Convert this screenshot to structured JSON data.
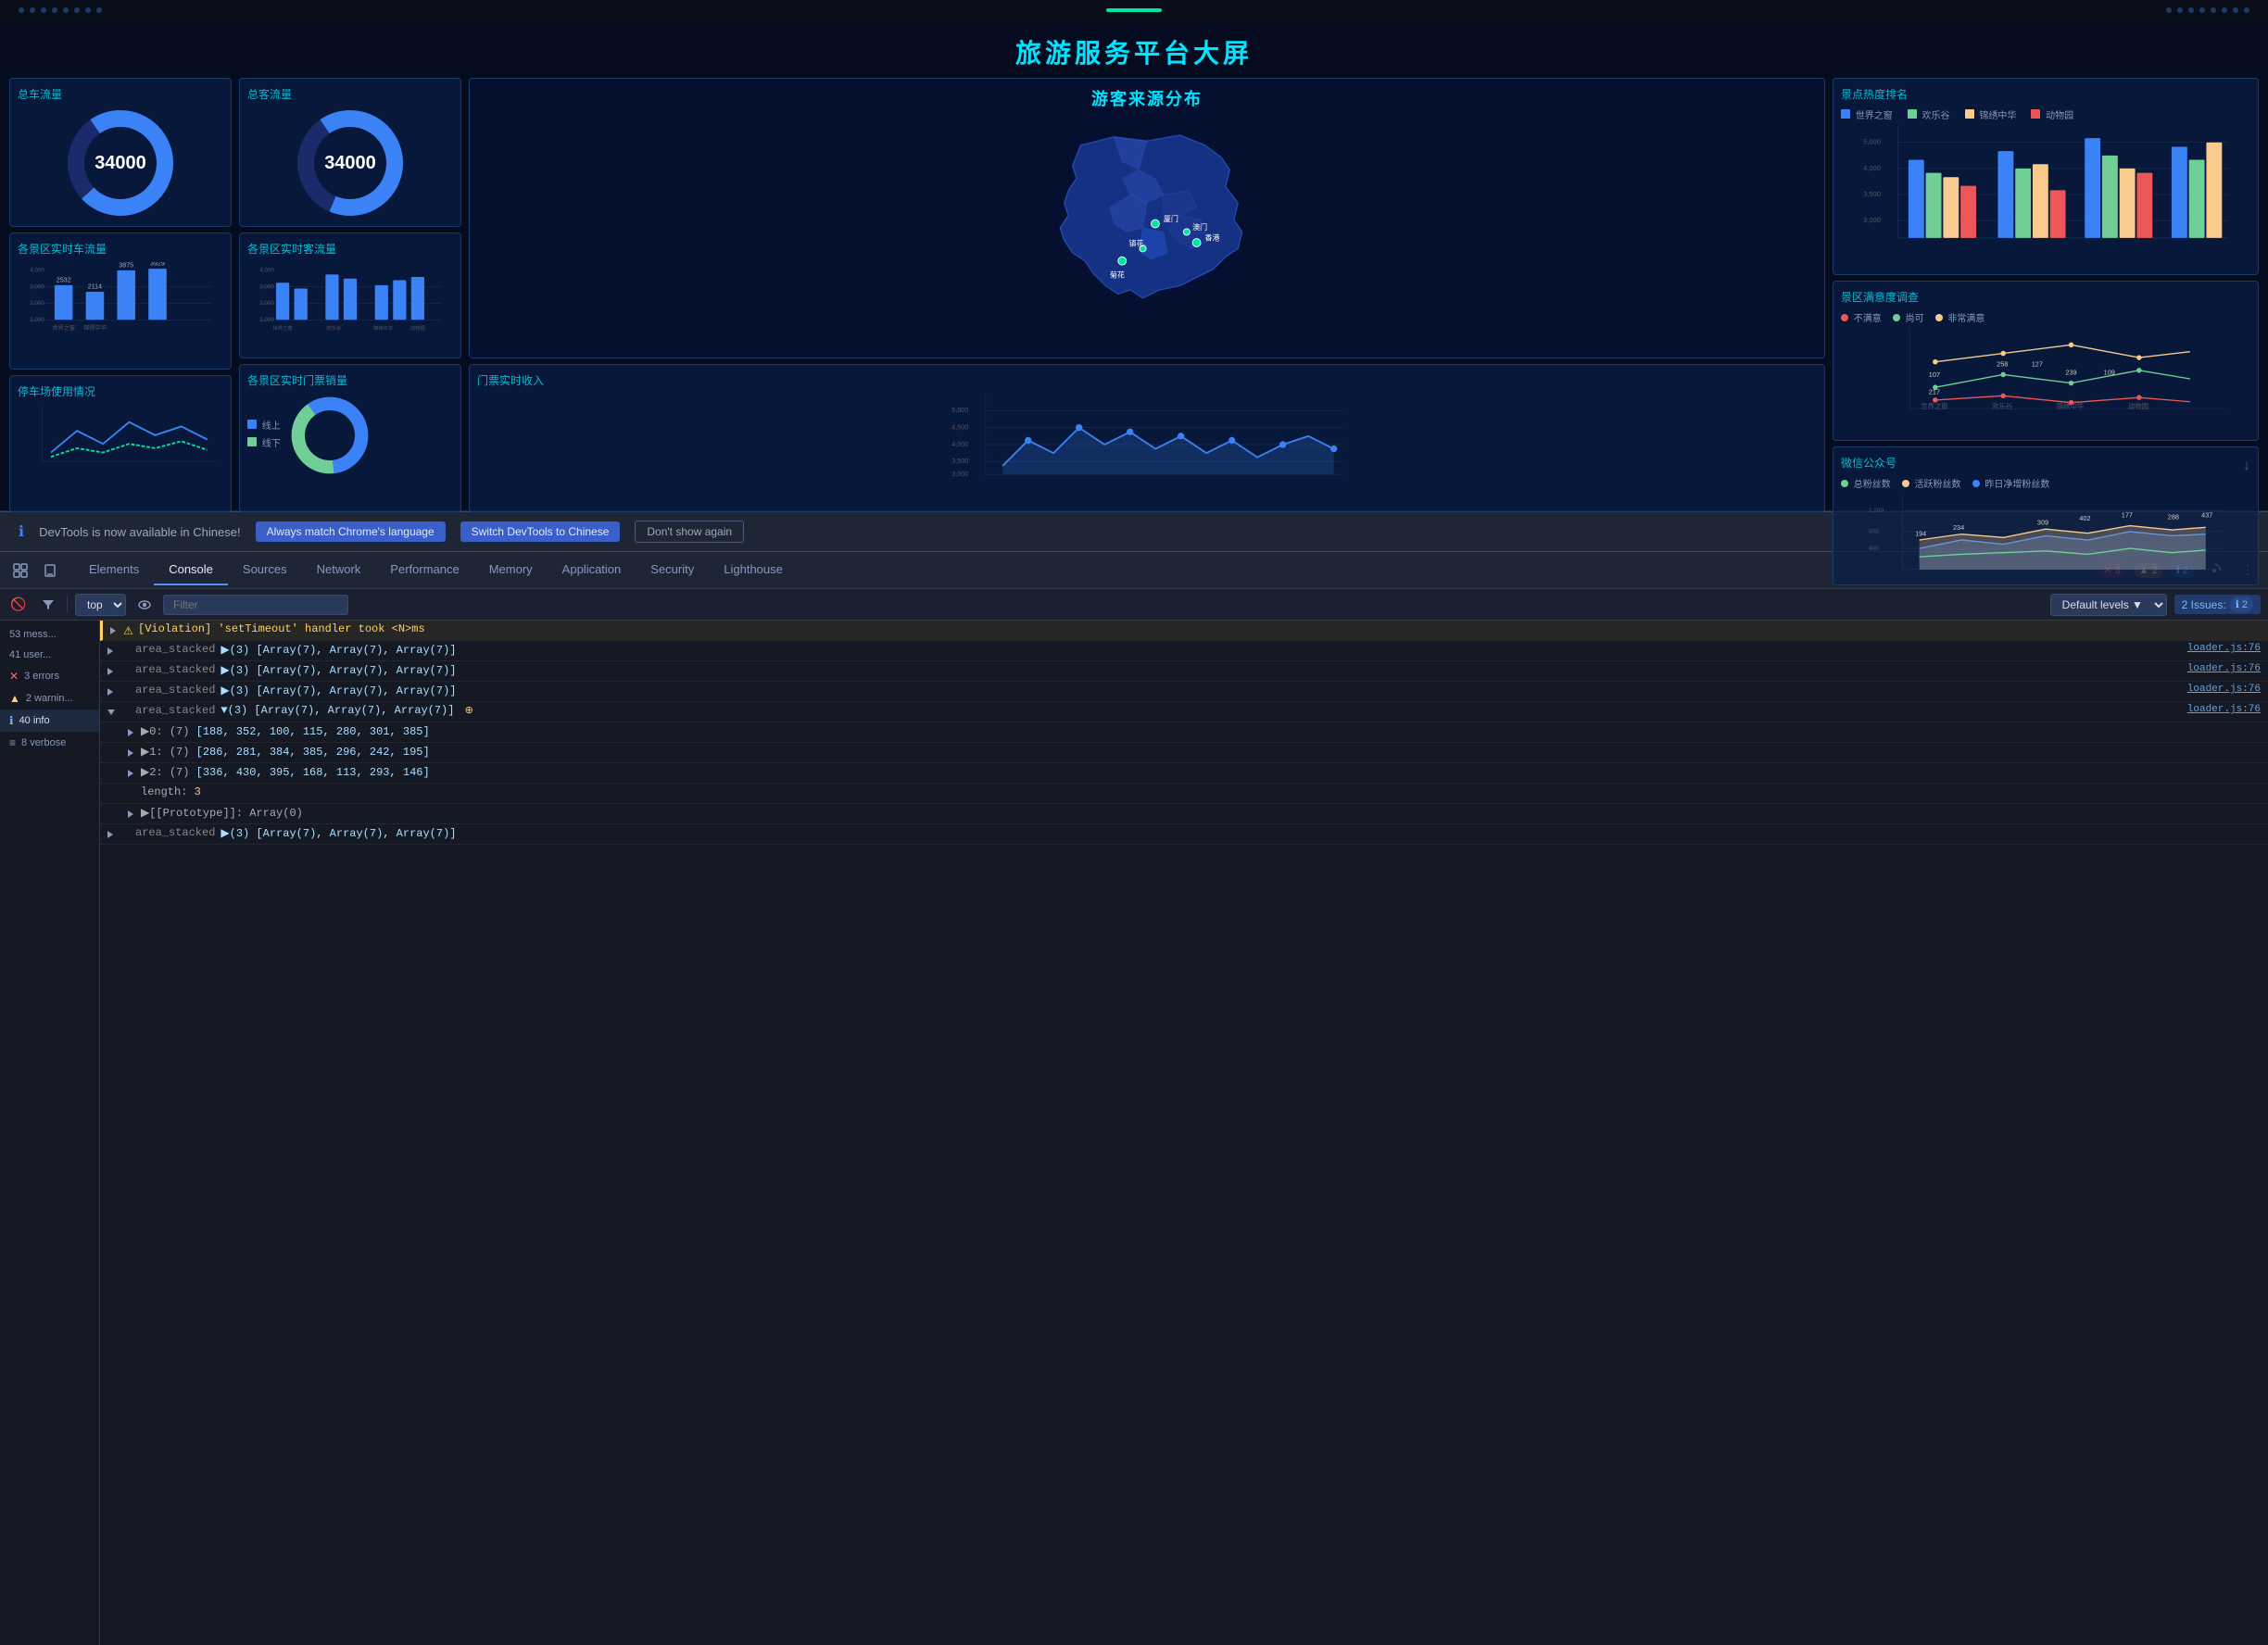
{
  "dashboard": {
    "title": "旅游服务平台大屏",
    "cards": {
      "total_car": "总车流量",
      "total_visitor": "总客流量",
      "car_value": "34000",
      "visitor_value": "34000",
      "realtime_car": "各景区实时车流量",
      "realtime_visitor": "各景区实时客流量",
      "parking": "停车场使用情况",
      "realtime_ticket": "各景区实时门票销量",
      "realtime_revenue": "门票实时收入",
      "satisfaction": "景区满意度调查",
      "spots_ranking": "景点热度排名",
      "wechat": "微信公众号",
      "visitor_source": "游客来源分布"
    },
    "bar_data_car": {
      "labels": [
        "世界之窗",
        "锦绣中华"
      ],
      "values": [
        "2532",
        "2114",
        "3875",
        "3929"
      ]
    },
    "satisfaction_labels": [
      "不满意",
      "尚可",
      "非常满意"
    ],
    "spots_legend": [
      "世界之窗",
      "欢乐谷",
      "锦绣中华",
      "动物园"
    ],
    "wechat_legend": [
      "总粉丝数",
      "活跃粉丝数",
      "昨日净增粉丝数"
    ],
    "online_offline": [
      "线上",
      "线下"
    ]
  },
  "notification": {
    "icon": "ℹ",
    "text": "DevTools is now available in Chinese!",
    "btn1": "Always match Chrome's language",
    "btn2": "Switch DevTools to Chinese",
    "btn3": "Don't show again"
  },
  "devtools": {
    "tabs": [
      "Elements",
      "Console",
      "Sources",
      "Network",
      "Performance",
      "Memory",
      "Application",
      "Security",
      "Lighthouse"
    ],
    "active_tab": "Console",
    "badges": {
      "errors": "3",
      "warnings": "2",
      "messages": "2"
    }
  },
  "console_toolbar": {
    "context": "top",
    "filter_placeholder": "Filter",
    "levels": "Default levels",
    "issues_label": "2 Issues:",
    "issues_count": "2"
  },
  "console_sidebar": {
    "items": [
      {
        "label": "53 mess...",
        "type": "all"
      },
      {
        "label": "41 user...",
        "type": "user"
      },
      {
        "label": "3 errors",
        "type": "error"
      },
      {
        "label": "2 warnin...",
        "type": "warning"
      },
      {
        "label": "40 info",
        "type": "info"
      },
      {
        "label": "8 verbose",
        "type": "verbose"
      }
    ]
  },
  "console_messages": [
    {
      "type": "violation",
      "icon": "⚠",
      "source": "[Violation]",
      "text": "'setTimeout' handler took <N>ms",
      "link": ""
    },
    {
      "type": "log",
      "expanded": false,
      "source": "area_stacked",
      "text": "▶(3) [Array(7), Array(7), Array(7)]",
      "link": "loader.js:76"
    },
    {
      "type": "log",
      "expanded": false,
      "source": "area_stacked",
      "text": "▶(3) [Array(7), Array(7), Array(7)]",
      "link": "loader.js:76"
    },
    {
      "type": "log",
      "expanded": false,
      "source": "area_stacked",
      "text": "▶(3) [Array(7), Array(7), Array(7)]",
      "link": "loader.js:76"
    },
    {
      "type": "log_expanded",
      "source": "area_stacked",
      "header": "▼(3) [Array(7), Array(7), Array(7)]",
      "children": [
        "▶0: (7) [188, 352, 100, 115, 280, 301, 385]",
        "▶1: (7) [286, 281, 384, 385, 296, 242, 195]",
        "▶2: (7) [336, 430, 395, 168, 113, 293, 146]",
        "length: 3",
        "▶[[Prototype]]: Array(0)"
      ],
      "link": "loader.js:76"
    },
    {
      "type": "log",
      "expanded": false,
      "source": "area_stacked",
      "text": "▶(3) [Array(7), Array(7), Array(7)]",
      "link": ""
    }
  ]
}
